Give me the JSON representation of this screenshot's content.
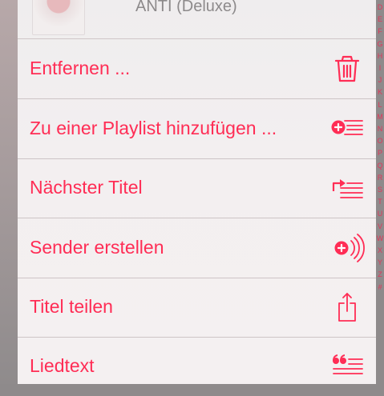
{
  "album": {
    "title": "ANTI (Deluxe)"
  },
  "menu": {
    "items": [
      {
        "label": "Entfernen ...",
        "icon": "trash-icon"
      },
      {
        "label": "Zu einer Playlist hinzufügen ...",
        "icon": "add-to-playlist-icon"
      },
      {
        "label": "Nächster Titel",
        "icon": "play-next-icon"
      },
      {
        "label": "Sender erstellen",
        "icon": "create-station-icon"
      },
      {
        "label": "Titel teilen",
        "icon": "share-icon"
      },
      {
        "label": "Liedtext",
        "icon": "lyrics-icon"
      }
    ]
  },
  "index_letters": [
    "D",
    "E",
    "F",
    "G",
    "H",
    "I",
    "J",
    "K",
    "L",
    "M",
    "N",
    "O",
    "P",
    "Q",
    "R",
    "S",
    "T",
    "U",
    "V",
    "W",
    "X",
    "Y",
    "Z",
    "#"
  ],
  "colors": {
    "accent": "#ff2d55",
    "separator": "#cdc4c6",
    "sheet": "#f3eff0"
  }
}
